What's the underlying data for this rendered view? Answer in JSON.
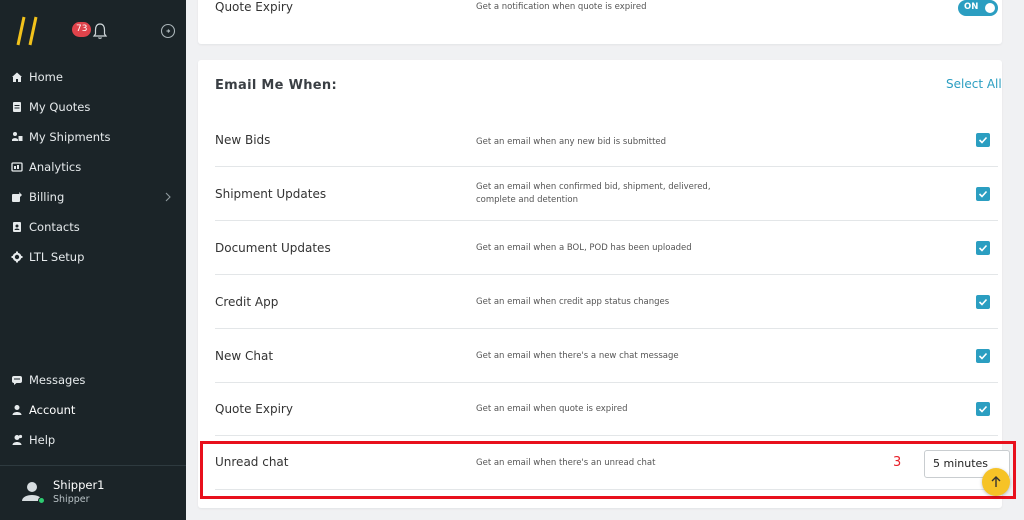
{
  "sidebar": {
    "notification_count": "73",
    "nav_items": [
      {
        "label": "Home",
        "icon": "home-icon"
      },
      {
        "label": "My Quotes",
        "icon": "document-icon"
      },
      {
        "label": "My Shipments",
        "icon": "shipments-icon"
      },
      {
        "label": "Analytics",
        "icon": "analytics-icon"
      },
      {
        "label": "Billing",
        "icon": "billing-icon"
      },
      {
        "label": "Contacts",
        "icon": "contacts-icon"
      },
      {
        "label": "LTL Setup",
        "icon": "gear-icon"
      }
    ],
    "bottom_items": [
      {
        "label": "Messages",
        "icon": "chat-icon"
      },
      {
        "label": "Account",
        "icon": "user-icon"
      },
      {
        "label": "Help",
        "icon": "help-icon"
      }
    ],
    "user": {
      "name": "Shipper1",
      "role": "Shipper"
    }
  },
  "top_row": {
    "title": "Quote Expiry",
    "description": "Get a notification when quote is expired",
    "toggle_label": "ON"
  },
  "email_section": {
    "title": "Email Me When:",
    "select_all": "Select All",
    "rows": [
      {
        "title": "New Bids",
        "description": "Get an email when any new bid is submitted"
      },
      {
        "title": "Shipment Updates",
        "description": "Get an email when confirmed bid, shipment, delivered, complete and detention"
      },
      {
        "title": "Document Updates",
        "description": "Get an email when a BOL, POD has been uploaded"
      },
      {
        "title": "Credit App",
        "description": "Get an email when credit app status changes"
      },
      {
        "title": "New Chat",
        "description": "Get an email when there's a new chat message"
      },
      {
        "title": "Quote Expiry",
        "description": "Get an email when quote is expired"
      }
    ],
    "unread": {
      "title": "Unread chat",
      "description": "Get an email when there's an unread chat",
      "step_number": "3",
      "select_value": "5 minutes"
    }
  },
  "colors": {
    "sidebar_bg": "#1b2428",
    "accent": "#2b9ec1",
    "badge": "#e0434b",
    "highlight": "#e8101c",
    "scroll_button": "#f6c327"
  }
}
